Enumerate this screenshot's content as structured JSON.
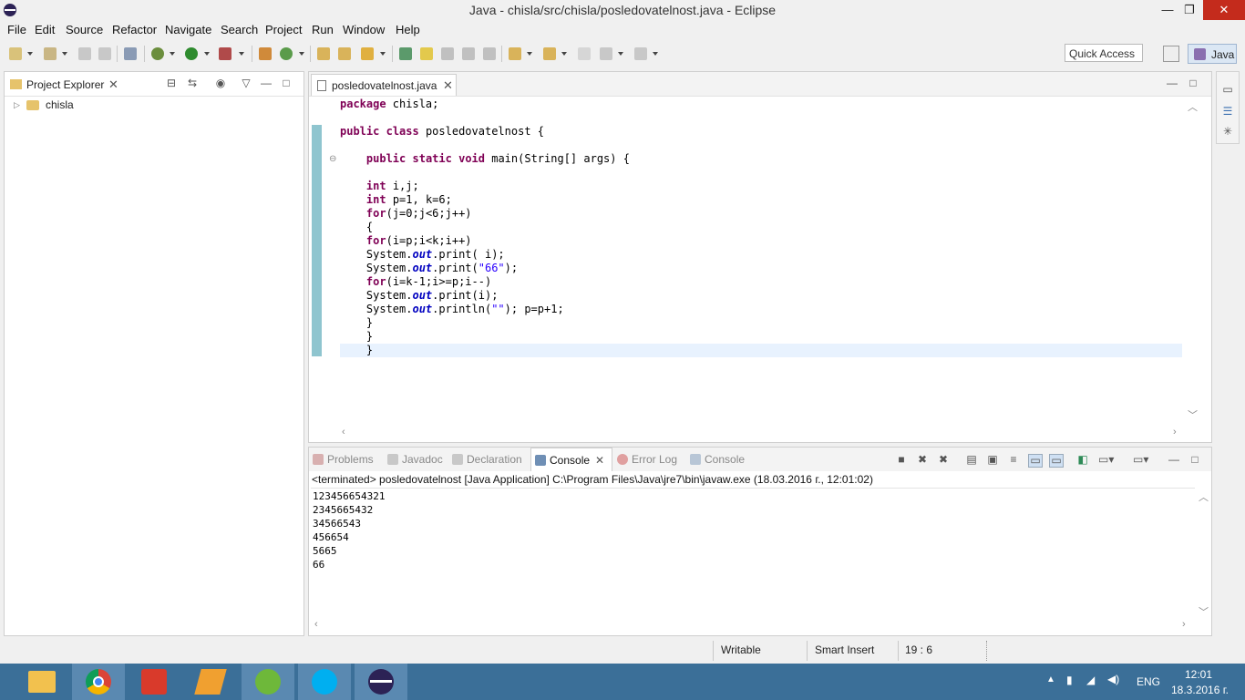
{
  "window": {
    "title": "Java - chisla/src/chisla/posledovatelnost.java - Eclipse",
    "minimize": "—",
    "maximize": "❐",
    "close": "✕"
  },
  "menu": [
    "File",
    "Edit",
    "Source",
    "Refactor",
    "Navigate",
    "Search",
    "Project",
    "Run",
    "Window",
    "Help"
  ],
  "toolbar": {
    "quick_access": "Quick Access",
    "perspective": "Java"
  },
  "project_explorer": {
    "tab_label": "Project Explorer",
    "tree": [
      {
        "label": "chisla"
      }
    ]
  },
  "editor": {
    "tab_label": "posledovatelnost.java",
    "lines": [
      "package chisla;",
      "",
      "public class posledovatelnost {",
      "",
      "    public static void main(String[] args) {",
      "",
      "    int i,j;",
      "    int p=1, k=6;",
      "    for(j=0;j<6;j++)",
      "    {",
      "    for(i=p;i<k;i++)",
      "    System.out.print( i);",
      "    System.out.print(\"66\");",
      "    for(i=k-1;i>=p;i--)",
      "    System.out.print(i);",
      "    System.out.println(\"\"); p=p+1;",
      "    }",
      "    }",
      "    }"
    ]
  },
  "bottom_tabs": [
    "Problems",
    "Javadoc",
    "Declaration",
    "Console",
    "Error Log",
    "Console"
  ],
  "console": {
    "terminated": "<terminated> posledovatelnost [Java Application] C:\\Program Files\\Java\\jre7\\bin\\javaw.exe (18.03.2016 г., 12:01:02)",
    "output": [
      "123456654321",
      "2345665432",
      "34566543",
      "456654",
      "5665",
      "66"
    ]
  },
  "status": {
    "writable": "Writable",
    "insert_mode": "Smart Insert",
    "position": "19 : 6"
  },
  "taskbar": {
    "apps": [
      "file-explorer",
      "chrome",
      "pdf-reader",
      "winamp",
      "utorrent",
      "skype",
      "eclipse"
    ],
    "language": "ENG",
    "time": "12:01",
    "date": "18.3.2016 г."
  },
  "colors": {
    "keyword": "#7f0055",
    "static_field": "#0000c0",
    "string": "#2a00ff",
    "taskbar": "#3b6f98",
    "close_button": "#c42b1c"
  }
}
